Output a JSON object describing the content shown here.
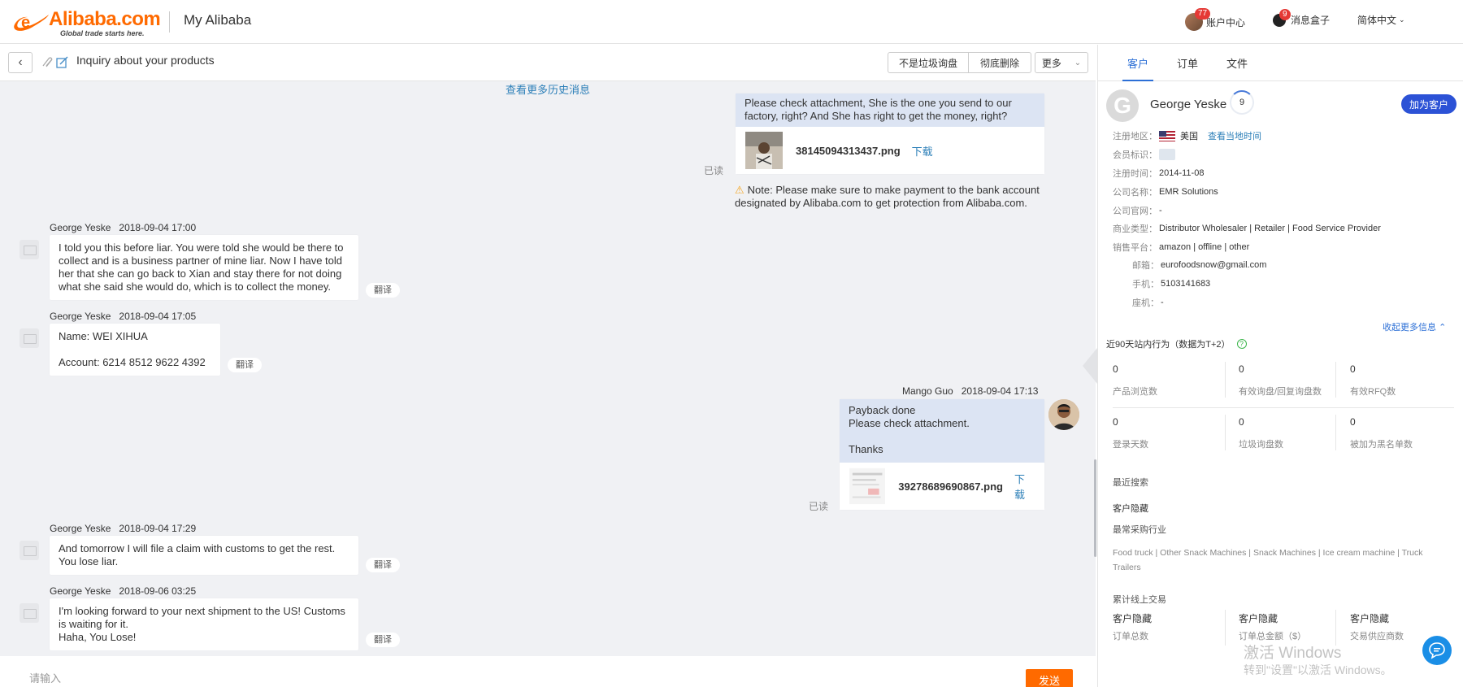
{
  "topbar": {
    "brand": "Alibaba.com",
    "tagline": "Global trade starts here.",
    "title": "My Alibaba",
    "account_badge": "77",
    "account_label": "账户中心",
    "message_badge": "9",
    "message_label": "消息盒子",
    "language_label": "简体中文"
  },
  "chat": {
    "subject": "Inquiry about your products",
    "btn_not_spam": "不是垃圾询盘",
    "btn_delete": "彻底删除",
    "btn_more": "更多",
    "history_link": "查看更多历史消息",
    "read_label": "已读",
    "translate_label": "翻译",
    "msg1_text": "Please check attachment, She is the one you send to our factory, right? And She has right to get the money, right?",
    "msg1_file": "38145094313437.png",
    "download_label": "下载",
    "note": "Note: Please make sure to make payment to the bank account designated by Alibaba.com to get protection from Alibaba.com.",
    "in1_name": "George Yeske",
    "in1_time": "2018-09-04 17:00",
    "in1_text": "I told you this before liar. You were told she would be there to collect and is a business partner of mine liar. Now I have told her that she can go back to Xian and stay there for not doing what she said she would do, which is to collect the money.",
    "in2_name": "George Yeske",
    "in2_time": "2018-09-04 17:05",
    "in2_line1": "Name: WEI XIHUA",
    "in2_line2": "Account: 6214 8512 9622 4392",
    "out2_name": "Mango Guo",
    "out2_time": "2018-09-04 17:13",
    "out2_line1": "Payback done",
    "out2_line2": "Please check attachment.",
    "out2_line3": "Thanks",
    "out2_file": "39278689690867.png",
    "in3_name": "George Yeske",
    "in3_time": "2018-09-04 17:29",
    "in3_text": "And tomorrow I will file a claim with customs to get the rest. You lose liar.",
    "in4_name": "George Yeske",
    "in4_time": "2018-09-06 03:25",
    "in4_line1": "I'm looking forward to your next shipment to the US!  Customs is waiting for it.",
    "in4_line2": "Haha, You Lose!",
    "input_placeholder": "请输入",
    "send_label": "发送"
  },
  "panel": {
    "tabs": [
      "客户",
      "订单",
      "文件"
    ],
    "avatar_letter": "G",
    "customer_name": "George Yeske",
    "score": "9",
    "add_customer": "加为客户",
    "region_label": "注册地区：",
    "region_value": "美国",
    "local_time_link": "查看当地时间",
    "member_label": "会员标识：",
    "reg_time_label": "注册时间：",
    "reg_time_value": "2014-11-08",
    "company_label": "公司名称：",
    "company_value": "EMR Solutions",
    "website_label": "公司官网：",
    "website_value": "-",
    "biz_type_label": "商业类型：",
    "biz_type_value": "Distributor Wholesaler | Retailer | Food Service Provider",
    "platform_label": "销售平台：",
    "platform_value": "amazon | offline | other",
    "email_label": "邮箱：",
    "email_value": "eurofoodsnow@gmail.com",
    "mobile_label": "手机：",
    "mobile_value": "5103141683",
    "phone_label": "座机：",
    "phone_value": "-",
    "more_info": "收起更多信息",
    "behavior_title": "近90天站内行为（数据为T+2）",
    "help_icon": "?",
    "stats": [
      {
        "value": "0",
        "label": "产品浏览数"
      },
      {
        "value": "0",
        "label": "有效询盘/回复询盘数"
      },
      {
        "value": "0",
        "label": "有效RFQ数"
      },
      {
        "value": "0",
        "label": "登录天数"
      },
      {
        "value": "0",
        "label": "垃圾询盘数"
      },
      {
        "value": "0",
        "label": "被加为黑名单数"
      }
    ],
    "recent_search": "最近搜索",
    "hidden": "客户隐藏",
    "top_industry": "最常采购行业",
    "industries": "Food truck | Other Snack Machines | Snack Machines | Ice cream machine | Truck Trailers",
    "online_trade": "累计线上交易",
    "trade_hidden_1": "客户隐藏",
    "trade_hidden_2": "客户隐藏",
    "trade_hidden_3": "客户隐藏",
    "trade_l1": "订单总数",
    "trade_l2": "订单总金额（$）",
    "trade_l3": "交易供应商数"
  },
  "watermark": {
    "line1": "激活 Windows",
    "line2": "转到\"设置\"以激活 Windows。"
  },
  "colors": {
    "brand_orange": "#ff6a00",
    "link_blue": "#2c7fb8",
    "primary_blue": "#2c52d6"
  }
}
